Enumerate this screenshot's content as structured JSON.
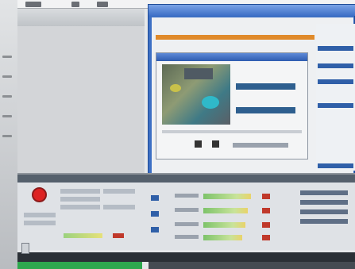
{
  "window": {
    "menu": [
      "",
      "",
      "",
      ""
    ]
  },
  "dialog": {
    "status_text": ""
  },
  "bottom_panel": {
    "record_state": "record",
    "rows": [
      {
        "meter_level": 0.85
      },
      {
        "meter_level": 0.8
      },
      {
        "meter_level": 0.75
      },
      {
        "meter_level": 0.7
      }
    ],
    "master_level": 0.7
  },
  "progress": {
    "fraction": 0.37
  },
  "colors": {
    "title_blue": "#3c6fc4",
    "accent_orange": "#e08a2a",
    "record_red": "#d22222",
    "progress_green": "#2ea84e"
  }
}
